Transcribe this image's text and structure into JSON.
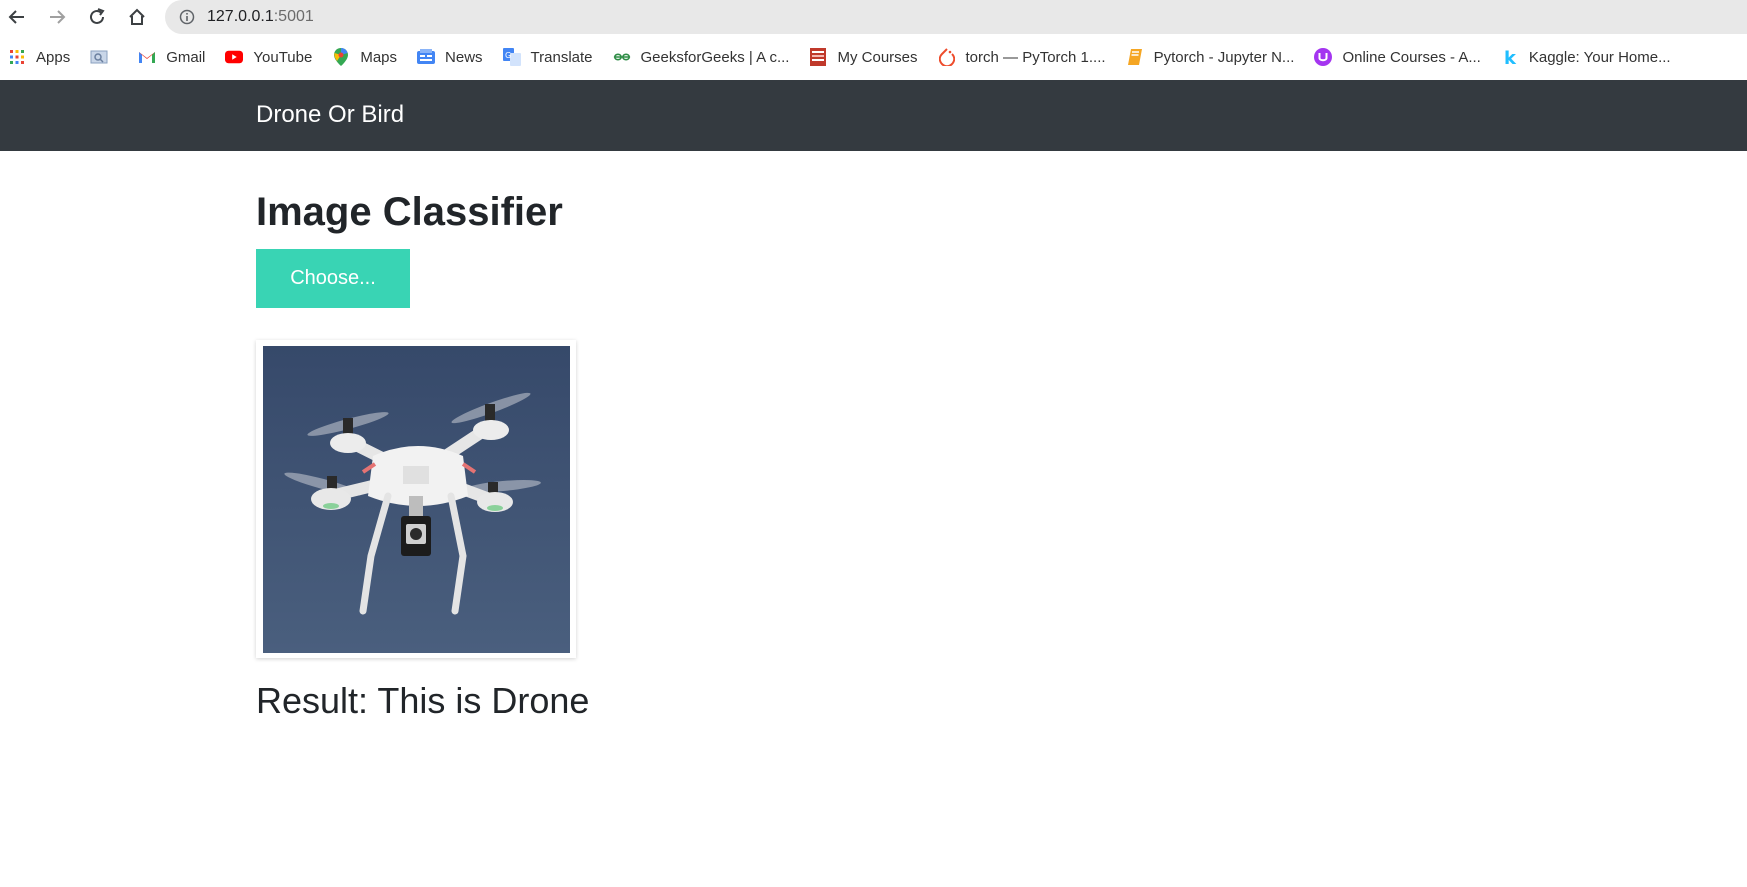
{
  "browser": {
    "url_host": "127.0.0.1",
    "url_port": ":5001",
    "bookmarks": [
      {
        "label": "Apps",
        "icon": "apps-grid-icon"
      },
      {
        "label": "",
        "icon": "image-search-icon"
      },
      {
        "label": "Gmail",
        "icon": "gmail-icon"
      },
      {
        "label": "YouTube",
        "icon": "youtube-icon"
      },
      {
        "label": "Maps",
        "icon": "maps-pin-icon"
      },
      {
        "label": "News",
        "icon": "news-icon"
      },
      {
        "label": "Translate",
        "icon": "translate-icon"
      },
      {
        "label": "GeeksforGeeks | A c...",
        "icon": "geeksforgeeks-icon"
      },
      {
        "label": "My Courses",
        "icon": "courses-icon"
      },
      {
        "label": "torch — PyTorch 1....",
        "icon": "pytorch-icon"
      },
      {
        "label": "Pytorch - Jupyter N...",
        "icon": "notebook-icon"
      },
      {
        "label": "Online Courses - A...",
        "icon": "udemy-icon"
      },
      {
        "label": "Kaggle: Your Home...",
        "icon": "kaggle-icon"
      }
    ]
  },
  "navbar": {
    "brand": "Drone Or Bird"
  },
  "main": {
    "title": "Image Classifier",
    "choose_label": "Choose...",
    "result": "Result: This is Drone"
  },
  "colors": {
    "navbar_bg": "#343a40",
    "button_bg": "#39d4b4",
    "image_bg": "#3a4f6e"
  }
}
